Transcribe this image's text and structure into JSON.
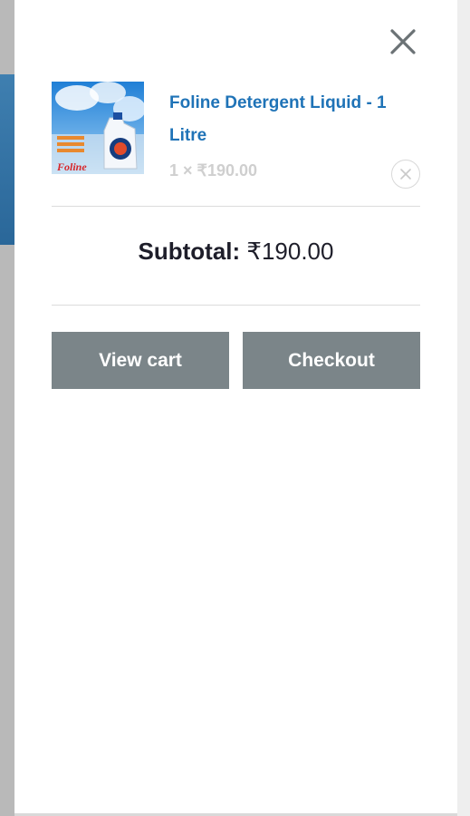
{
  "cart": {
    "item": {
      "title": "Foline Detergent Liquid - 1 Litre",
      "quantity_price": "1 × ₹190.00",
      "thumbnail_brand_text": "Foline"
    },
    "subtotal_label": "Subtotal:",
    "subtotal_value": "₹190.00",
    "buttons": {
      "view_cart": "View cart",
      "checkout": "Checkout"
    }
  },
  "icons": {
    "close": "close-icon",
    "remove": "remove-item-icon"
  },
  "colors": {
    "link": "#1f73b7",
    "button_bg": "#7b8589",
    "button_text": "#ffffff",
    "muted_text": "#cfcfcf",
    "heading_text": "#1e1e2a"
  }
}
